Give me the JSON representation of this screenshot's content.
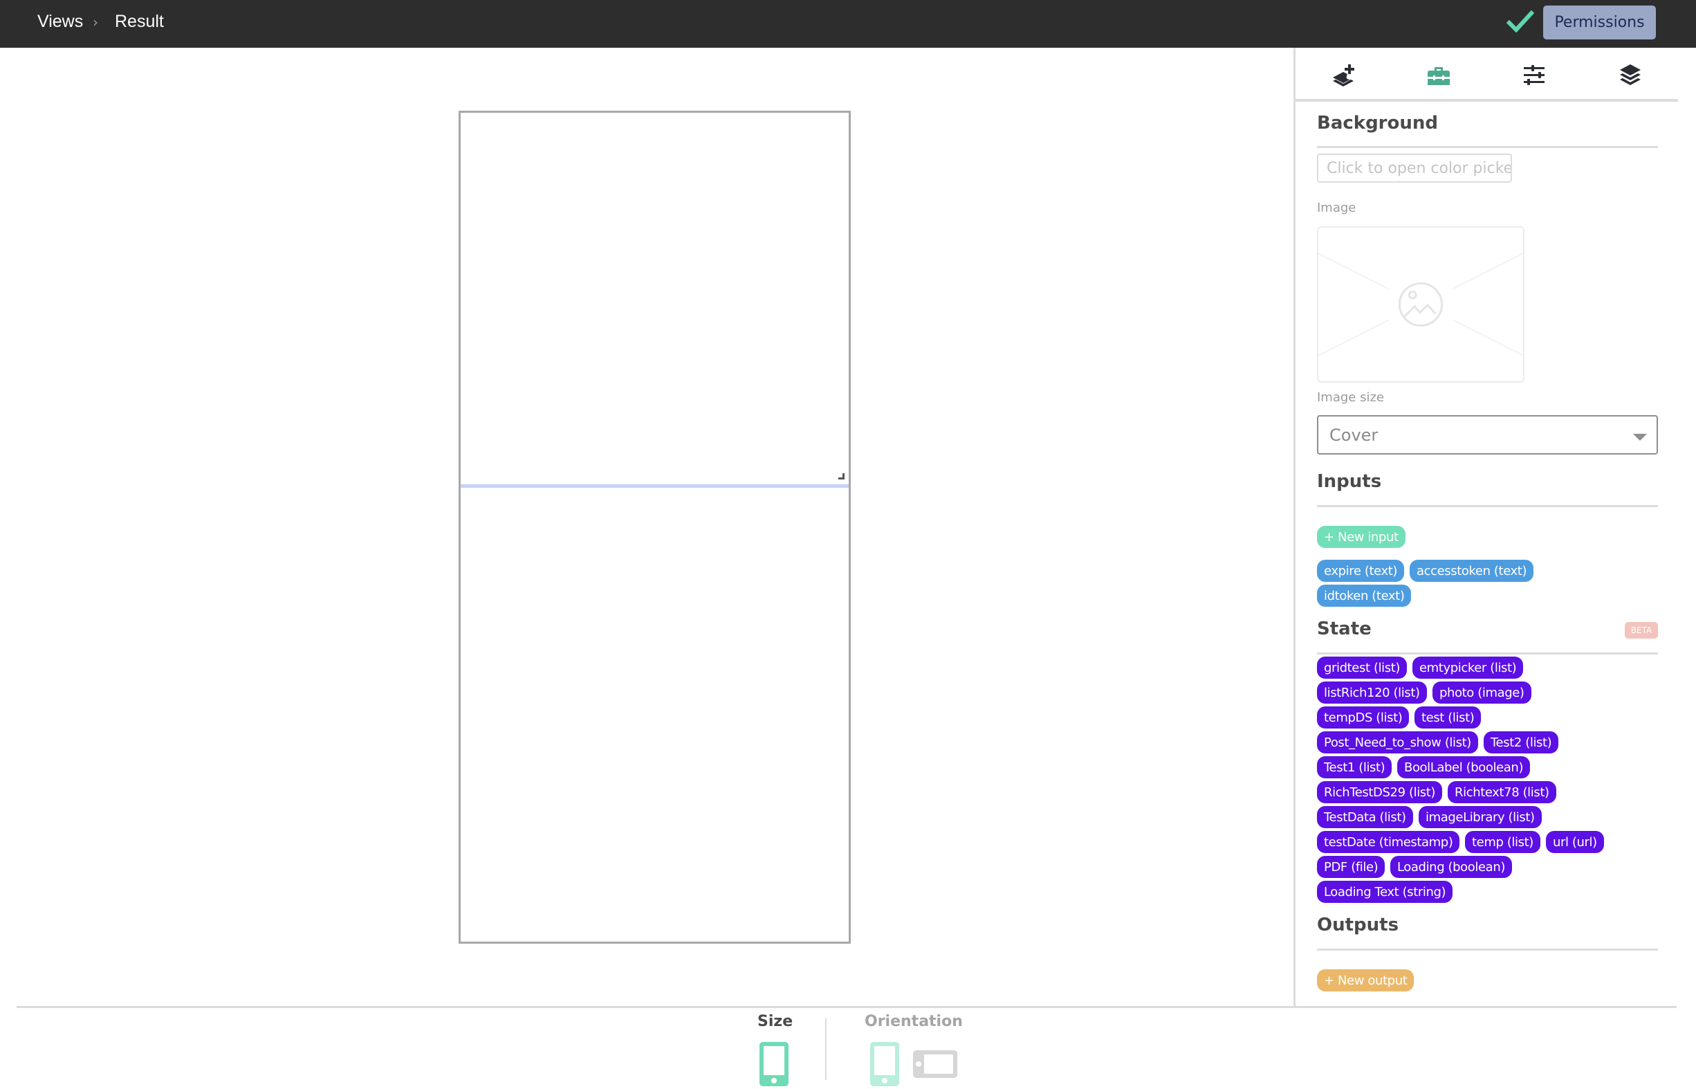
{
  "topbar": {
    "breadcrumb": [
      "Views",
      "Result"
    ],
    "separator": "›",
    "status_icon": "check-icon",
    "permissions_label": "Permissions"
  },
  "colors": {
    "topbar_bg": "#2d2d2d",
    "accent_green": "#5fd6ac",
    "permissions_bg": "#9aa7c7",
    "active_tab": "#4caa8f",
    "input_pill": "#4e9ce0",
    "state_pill": "#5c10e3",
    "new_input_pill": "#72dfb8",
    "new_output_pill": "#ebb869",
    "beta_badge": "#f3c3bd",
    "canvas_split": "#c3d3f5"
  },
  "panel": {
    "tabs": [
      {
        "icon": "add-layer-icon",
        "active": false
      },
      {
        "icon": "toolbox-icon",
        "active": true
      },
      {
        "icon": "sliders-icon",
        "active": false
      },
      {
        "icon": "layers-icon",
        "active": false
      }
    ],
    "background": {
      "title": "Background",
      "color_placeholder": "Click to open color picker",
      "image_label": "Image",
      "image_size_label": "Image size",
      "image_size_value": "Cover"
    },
    "inputs": {
      "title": "Inputs",
      "new_label": "+ New input",
      "items": [
        "expire (text)",
        "accesstoken (text)",
        "idtoken (text)"
      ]
    },
    "state": {
      "title": "State",
      "badge": "BETA",
      "items": [
        "gridtest (list)",
        "emtypicker (list)",
        "listRich120 (list)",
        "photo (image)",
        "tempDS (list)",
        "test (list)",
        "Post_Need_to_show (list)",
        "Test2 (list)",
        "Test1 (list)",
        "BoolLabel (boolean)",
        "RichTestDS29 (list)",
        "Richtext78 (list)",
        "TestData (list)",
        "imageLibrary (list)",
        "testDate (timestamp)",
        "temp (list)",
        "url (url)",
        "PDF (file)",
        "Loading (boolean)",
        "Loading Text (string)"
      ]
    },
    "outputs": {
      "title": "Outputs",
      "new_label": "+ New output"
    }
  },
  "footer": {
    "size_label": "Size",
    "orientation_label": "Orientation",
    "size_selected": "phone",
    "orientation_selected": "portrait"
  }
}
